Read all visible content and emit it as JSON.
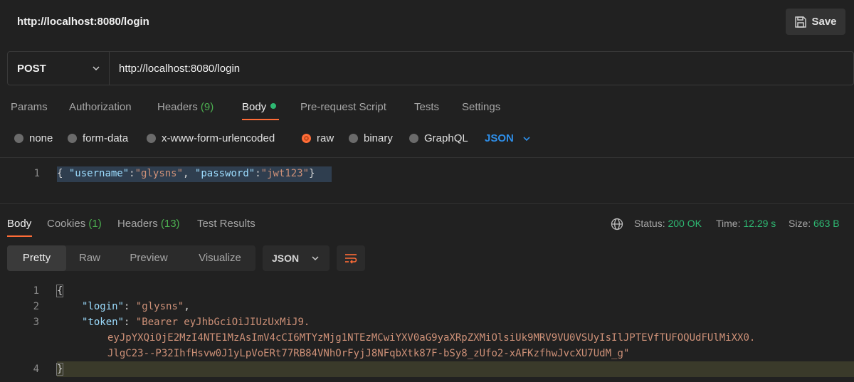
{
  "window": {
    "title": "http://localhost:8080/login",
    "save_label": "Save"
  },
  "request": {
    "method": "POST",
    "url": "http://localhost:8080/login",
    "tabs": {
      "params": "Params",
      "authorization": "Authorization",
      "headers": "Headers",
      "headers_count": "(9)",
      "body": "Body",
      "prerequest": "Pre-request Script",
      "tests": "Tests",
      "settings": "Settings"
    },
    "body_types": {
      "none": "none",
      "form_data": "form-data",
      "urlencoded": "x-www-form-urlencoded",
      "raw": "raw",
      "binary": "binary",
      "graphql": "GraphQL",
      "format": "JSON"
    },
    "body_line_number": "1",
    "body": {
      "open": "{",
      "key1": "\"username\"",
      "val1": "\"glysns\"",
      "key2": "\"password\"",
      "val2": "\"jwt123\"",
      "close": "}"
    }
  },
  "response": {
    "tabs": {
      "body": "Body",
      "cookies": "Cookies",
      "cookies_count": "(1)",
      "headers": "Headers",
      "headers_count": "(13)",
      "test_results": "Test Results"
    },
    "status_label": "Status:",
    "status_value": "200 OK",
    "time_label": "Time:",
    "time_value": "12.29 s",
    "size_label": "Size:",
    "size_value": "663 B",
    "views": {
      "pretty": "Pretty",
      "raw": "Raw",
      "preview": "Preview",
      "visualize": "Visualize"
    },
    "format": "JSON",
    "lines": [
      "1",
      "2",
      "3",
      "4"
    ],
    "json": {
      "open": "{",
      "login_key": "\"login\"",
      "login_val": "\"glysns\"",
      "token_key": "\"token\"",
      "token_val_1": "\"Bearer eyJhbGciOiJIUzUxMiJ9.",
      "token_val_2": "eyJpYXQiOjE2MzI4NTE1MzAsImV4cCI6MTYzMjg1NTEzMCwiYXV0aG9yaXRpZXMiOlsiUk9MRV9VU0VSUyIsIlJPTEVfTUFOQUdFUlMiXX0.",
      "token_val_3": "JlgC23--P32IhfHsvw0J1yLpVoERt77RB84VNhOrFyjJ8NFqbXtk87F-bSy8_zUfo2-xAFKzfhwJvcXU7UdM_g\"",
      "close": "}"
    }
  }
}
